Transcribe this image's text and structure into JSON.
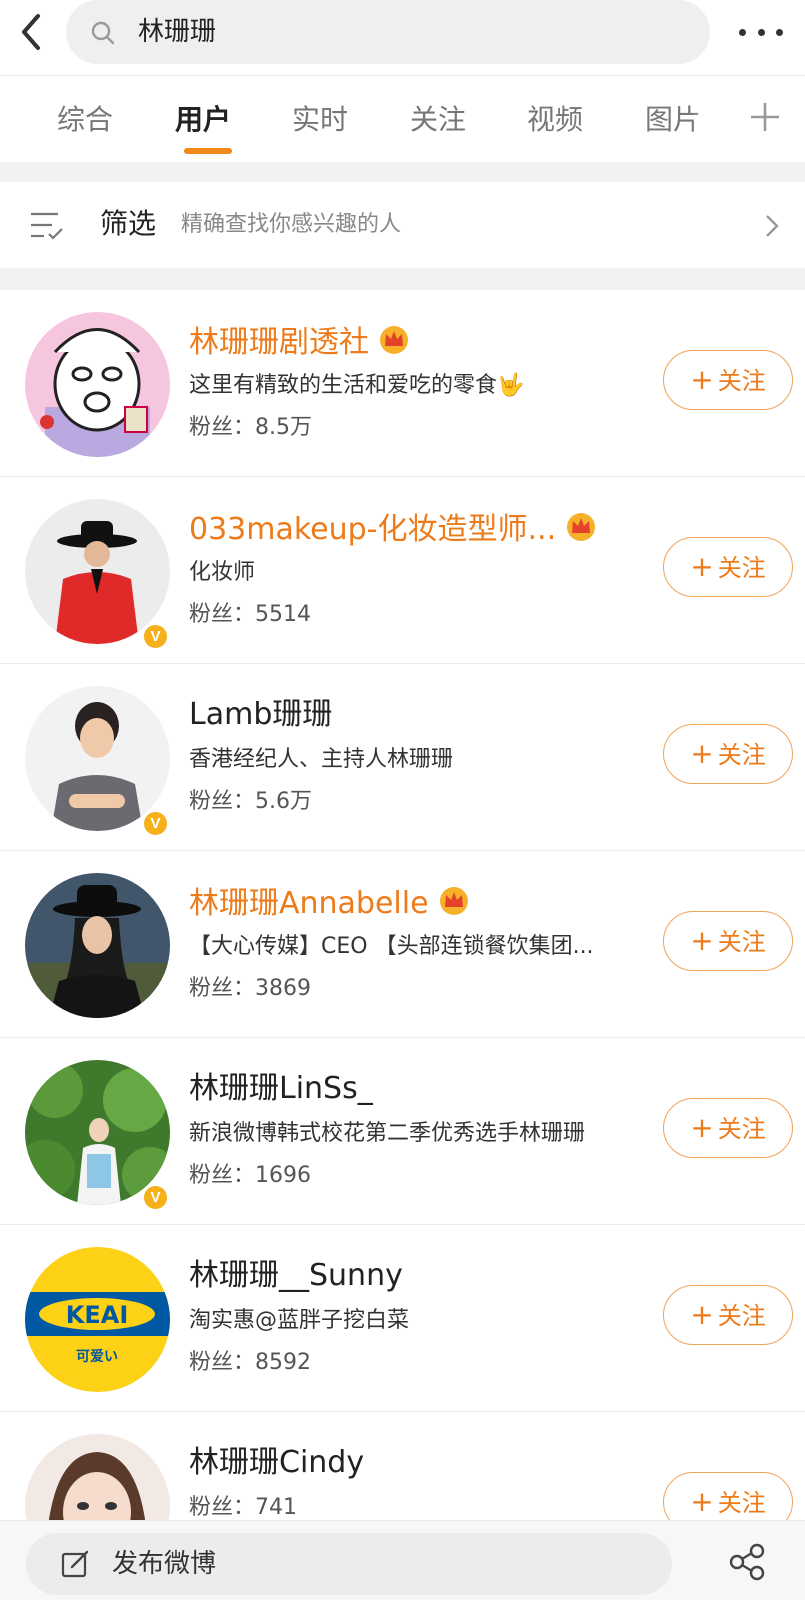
{
  "search": {
    "query": "林珊珊"
  },
  "tabs": [
    {
      "label": "综合",
      "active": false
    },
    {
      "label": "用户",
      "active": true
    },
    {
      "label": "实时",
      "active": false
    },
    {
      "label": "关注",
      "active": false
    },
    {
      "label": "视频",
      "active": false
    },
    {
      "label": "图片",
      "active": false
    }
  ],
  "filter": {
    "label": "筛选",
    "description": "精确查找你感兴趣的人"
  },
  "follow_label": "关注",
  "users": [
    {
      "name": "林珊珊剧透社",
      "vip": true,
      "crown": true,
      "verified": false,
      "bio": "这里有精致的生活和爱吃的零食🤟",
      "fans": "粉丝：8.5万"
    },
    {
      "name": "033makeup-化妆造型师...",
      "vip": true,
      "crown": true,
      "verified": true,
      "bio": "化妆师",
      "fans": "粉丝：5514"
    },
    {
      "name": "Lamb珊珊",
      "vip": false,
      "crown": false,
      "verified": true,
      "bio": "香港经纪人、主持人林珊珊",
      "fans": "粉丝：5.6万"
    },
    {
      "name": "林珊珊Annabelle",
      "vip": true,
      "crown": true,
      "verified": false,
      "bio": "【大心传媒】CEO 【头部连锁餐饮集团...",
      "fans": "粉丝：3869"
    },
    {
      "name": "林珊珊LinSs_",
      "vip": false,
      "crown": false,
      "verified": true,
      "bio": "新浪微博韩式校花第二季优秀选手林珊珊",
      "fans": "粉丝：1696"
    },
    {
      "name": "林珊珊__Sunny",
      "vip": false,
      "crown": false,
      "verified": false,
      "bio": "淘实惠@蓝胖子挖白菜",
      "fans": "粉丝：8592"
    },
    {
      "name": "林珊珊Cindy",
      "vip": false,
      "crown": false,
      "verified": false,
      "bio": "",
      "fans": "粉丝：741"
    }
  ],
  "avatar_logo": {
    "brand": "KEAI",
    "subtitle": "可爱い"
  },
  "verified_mark": "V",
  "bottom": {
    "compose_label": "发布微博"
  },
  "colors": {
    "accent": "#ee7b1a",
    "follow_border": "#f0a35a",
    "tab_underline": "#f28a1b",
    "badge": "#f5b01a"
  }
}
